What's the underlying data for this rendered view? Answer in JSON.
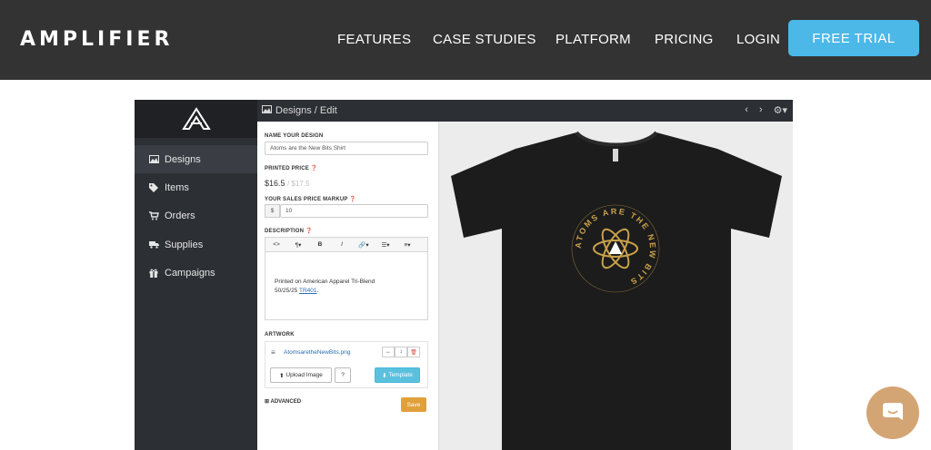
{
  "site": {
    "brand": "AMPLIFIER",
    "nav": [
      "FEATURES",
      "CASE STUDIES",
      "PLATFORM",
      "PRICING",
      "LOGIN"
    ],
    "cta": "FREE TRIAL"
  },
  "app": {
    "breadcrumb": "Designs / Edit",
    "sidebar": [
      {
        "label": "Designs",
        "icon": "image-icon",
        "active": true
      },
      {
        "label": "Items",
        "icon": "tag-icon"
      },
      {
        "label": "Orders",
        "icon": "cart-icon"
      },
      {
        "label": "Supplies",
        "icon": "truck-icon"
      },
      {
        "label": "Campaigns",
        "icon": "gift-icon"
      }
    ],
    "form": {
      "name_label": "NAME YOUR DESIGN",
      "name_value": "Atoms are the New Bits Shirt",
      "printed_price_label": "PRINTED PRICE",
      "price": "$16.5",
      "price_old": "/ $17.5",
      "markup_label": "YOUR SALES PRICE MARKUP",
      "currency": "$",
      "markup_value": "10",
      "description_label": "DESCRIPTION",
      "description_text": "Printed on American Apparel Tri-Blend",
      "description_text2": "50/25/25",
      "description_link": "TR401",
      "artwork_label": "ARTWORK",
      "artwork_file": "AtomsaretheNewBits.png",
      "upload_btn": "Upload Image",
      "help_btn": "?",
      "template_btn": "Template",
      "advanced": "ADVANCED",
      "save": "Save"
    },
    "shirt_text": "ATOMS ARE THE NEW BITS"
  },
  "colors": {
    "topbar": "#333333",
    "cta": "#4bb8e8",
    "sidebar": "#2c2f33",
    "shirt": "#1c1c1c",
    "gold": "#c8a14a",
    "chat": "#d4a574"
  }
}
